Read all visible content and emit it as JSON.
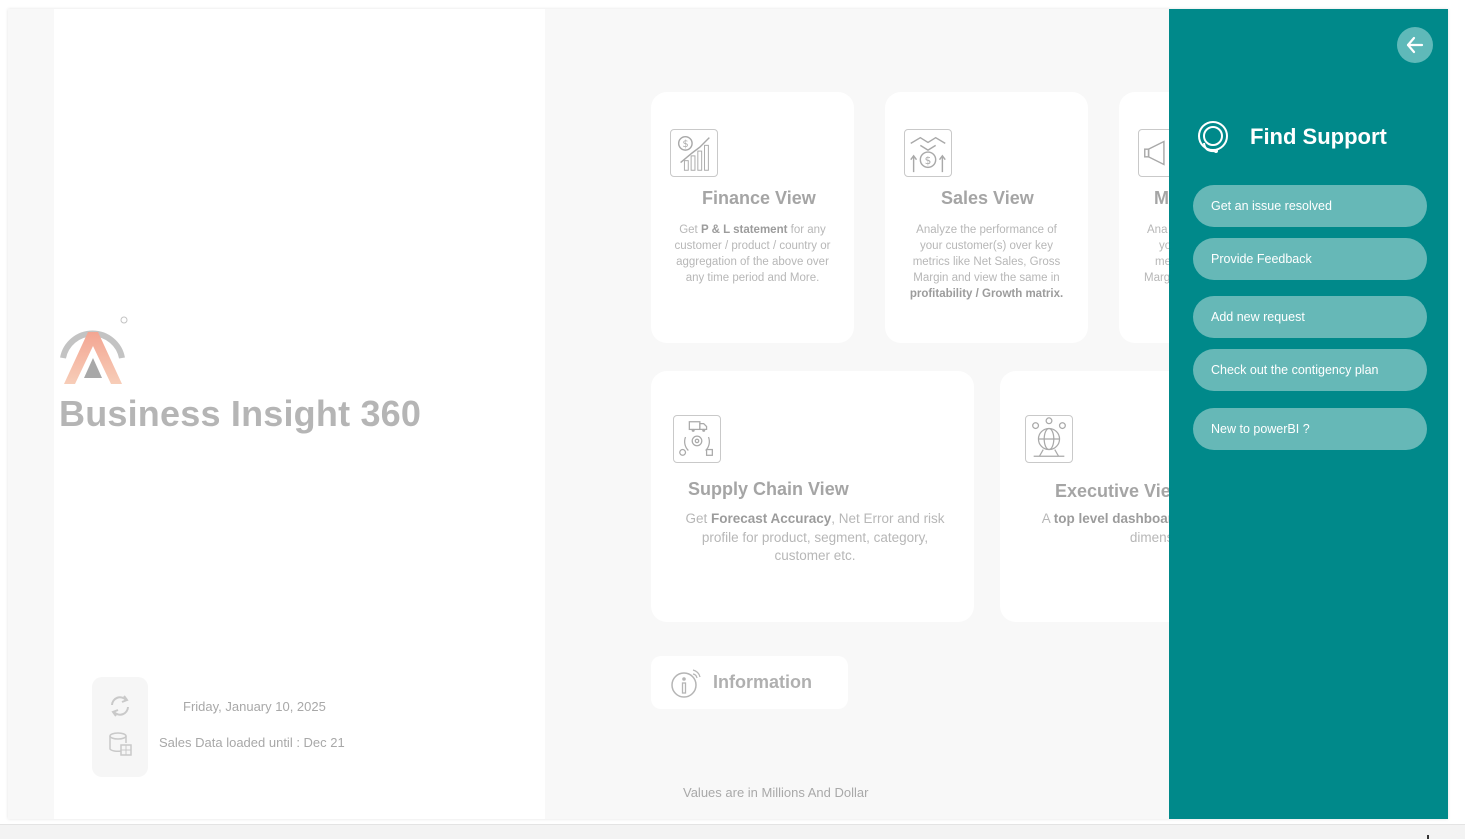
{
  "app": {
    "title": "Business Insight 360",
    "status_date": "Friday, January 10, 2025",
    "data_loaded": "Sales Data loaded until : Dec 21",
    "footer_note": "Values are in Millions And Dollar"
  },
  "cards": {
    "finance": {
      "title": "Finance View",
      "desc_1": "Get ",
      "desc_bold": "P & L statement",
      "desc_2": " for any customer / product / country or aggregation of the above over any time period and More."
    },
    "sales": {
      "title": "Sales View",
      "desc_1": "Analyze the performance of your customer(s) over key metrics like Net Sales, Gross Margin and view the same in ",
      "desc_bold": "profitability / Growth matrix."
    },
    "marketing": {
      "title": "M",
      "desc_lines": [
        "Ana",
        "yo",
        "met",
        "Marg",
        "p"
      ]
    },
    "supply_chain": {
      "title": "Supply Chain View",
      "desc_1": "Get ",
      "desc_bold": "Forecast Accuracy",
      "desc_2": ", Net Error and risk profile for product, segment, category, customer etc."
    },
    "executive": {
      "title": "Executive View",
      "desc_1": "A ",
      "desc_bold": "top level dashboard",
      "desc_2": " consolidating top dimensions"
    }
  },
  "information": {
    "label": "Information"
  },
  "support": {
    "title": "Find Support",
    "buttons": [
      {
        "label": "Get an issue resolved"
      },
      {
        "label": "Provide Feedback"
      },
      {
        "label": "Add new request"
      },
      {
        "label": "Check out the contigency plan"
      },
      {
        "label": "New to powerBI ?"
      }
    ]
  },
  "colors": {
    "panel": "#00898a",
    "panel_button": "#66b8b7",
    "title_gray": "#b5b5b5",
    "logo_gradient": [
      "#f3a592",
      "#f7cdb8"
    ]
  },
  "icons": {
    "back": "arrow-left-icon",
    "support": "headset-icon",
    "finance": "finance-chart-icon",
    "sales": "handshake-dollar-icon",
    "marketing": "megaphone-icon",
    "supply_chain": "truck-gear-icon",
    "executive": "globe-network-icon",
    "info": "info-icon",
    "refresh": "refresh-icon",
    "database": "database-icon"
  }
}
